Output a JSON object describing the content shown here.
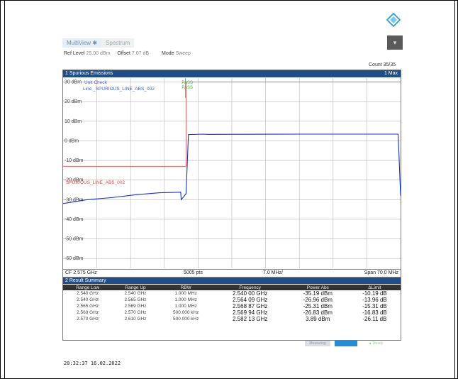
{
  "tabs": [
    {
      "label": "MultiView"
    },
    {
      "label": "Spectrum"
    }
  ],
  "info": {
    "ref_label": "Ref Level",
    "ref_value": "25.00 dBm",
    "offset_label": "Offset",
    "offset_value": "7.07 dB",
    "mode_label": "Mode",
    "mode_value": "Sweep"
  },
  "count": "Count 35/35",
  "panel": {
    "title": "1 Spurious Emissions",
    "right": "1 Max"
  },
  "limit": {
    "check_label": "Unit Check",
    "line_label": "Line _SPURIOUS_LINE_ABS_002",
    "pass1": "PASS",
    "pass2": "PASS",
    "marker": "SPURIOUS_LINE_ABS_002"
  },
  "chart_data": {
    "type": "line",
    "ylabels": [
      "30 dBm",
      "20 dBm",
      "10 dBm",
      "0 dBm",
      "-10 dBm",
      "-20 dBm",
      "-30 dBm",
      "-40 dBm",
      "-50 dBm",
      "-60 dBm"
    ],
    "ylim": [
      -65,
      32
    ],
    "xlim": [
      2.54,
      2.61
    ],
    "series": [
      {
        "x": [
          2.54,
          2.545,
          2.55,
          2.555,
          2.56,
          2.5644,
          2.5645,
          2.5655,
          2.566,
          2.569,
          2.57,
          2.59,
          2.605,
          2.6095,
          2.61
        ],
        "y": [
          -32,
          -30,
          -29,
          -27.5,
          -26.5,
          -26.2,
          -30,
          -27,
          3.2,
          3.4,
          3.3,
          3.4,
          3.4,
          3.4,
          -28
        ]
      }
    ],
    "limit_line": {
      "x": [
        2.54,
        2.5645,
        2.5645,
        2.5655,
        2.5655,
        2.61
      ],
      "y": [
        -13,
        -13,
        -13,
        -13,
        30,
        30
      ]
    }
  },
  "axis_footer": {
    "cf": "CF 2.575 GHz",
    "pts": "5005 pts",
    "div": "7.0 MHz/",
    "span": "Span 70.0 MHz"
  },
  "result": {
    "title": "2 Result Summary",
    "headers": [
      "Range Low",
      "Range Up",
      "RBW",
      "Frequency",
      "Power Abs",
      "ΔLimit"
    ],
    "rows": [
      [
        "2.540 GHz",
        "2.540 GHz",
        "1.000 MHz",
        "2.540 00 GHz",
        "-35.19 dBm",
        "-10.19 dB"
      ],
      [
        "2.540 GHz",
        "2.565 GHz",
        "1.000 MHz",
        "2.564 09 GHz",
        "-26.96 dBm",
        "-13.96 dB"
      ],
      [
        "2.565 GHz",
        "2.569 GHz",
        "1.000 MHz",
        "2.568 87 GHz",
        "-25.31 dBm",
        "-15.31 dB"
      ],
      [
        "2.569 GHz",
        "2.570 GHz",
        "500.000 kHz",
        "2.569 94 GHz",
        "-26.83 dBm",
        "-16.83 dB"
      ],
      [
        "2.570 GHz",
        "2.610 GHz",
        "500.000 kHz",
        "2.582 13 GHz",
        "3.89 dBm",
        "-26.11 dB"
      ]
    ]
  },
  "status": {
    "s1": "Measuring",
    "s3": "Ready"
  },
  "timestamp": "20:32:37  16.02.2022",
  "colors": {
    "trace": "#1a2fd0",
    "limit": "#e24a4a",
    "pass": "#2fbf2f",
    "title_bg": "#1f4f8a"
  }
}
